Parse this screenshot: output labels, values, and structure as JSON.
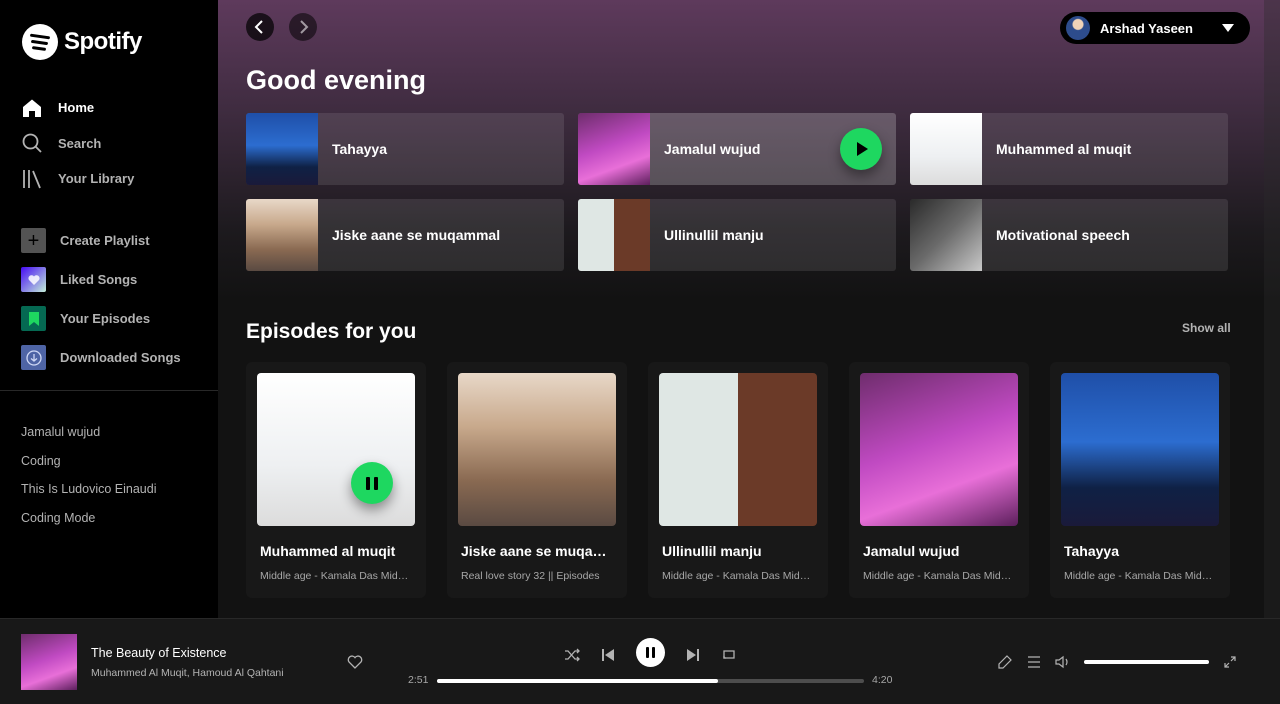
{
  "app": {
    "name": "Spotify"
  },
  "sidebar": {
    "nav": [
      {
        "label": "Home",
        "icon": "home-icon",
        "active": true
      },
      {
        "label": "Search",
        "icon": "search-icon"
      },
      {
        "label": "Your Library",
        "icon": "library-icon"
      }
    ],
    "actions": [
      {
        "label": "Create Playlist",
        "icon": "plus-icon"
      },
      {
        "label": "Liked Songs",
        "icon": "heart-icon"
      },
      {
        "label": "Your Episodes",
        "icon": "bookmark-icon"
      },
      {
        "label": "Downloaded Songs",
        "icon": "download-icon"
      }
    ],
    "playlists": [
      "Jamalul wujud",
      "Coding",
      "This Is Ludovico Einaudi",
      "Coding Mode"
    ]
  },
  "header": {
    "user_name": "Arshad Yaseen"
  },
  "main": {
    "greeting": "Good evening",
    "quick_picks": [
      {
        "label": "Tahayya"
      },
      {
        "label": "Jamalul wujud"
      },
      {
        "label": "Muhammed al muqit"
      },
      {
        "label": "Jiske aane se muqammal"
      },
      {
        "label": "Ullinullil manju"
      },
      {
        "label": "Motivational speech"
      }
    ],
    "episodes": {
      "title": "Episodes for you",
      "show_all": "Show all",
      "cards": [
        {
          "title": "Muhammed al muqit",
          "subtitle": "Middle age - Kamala Das Middle age..."
        },
        {
          "title": "Jiske aane se muqammal",
          "subtitle": "Real love story 32 || Episodes"
        },
        {
          "title": "Ullinullil manju",
          "subtitle": "Middle age - Kamala Das Middle age..."
        },
        {
          "title": "Jamalul wujud",
          "subtitle": "Middle age - Kamala Das Middle age..."
        },
        {
          "title": "Tahayya",
          "subtitle": "Middle age - Kamala Das Middle age..."
        }
      ]
    }
  },
  "player": {
    "track_title": "The Beauty of Existence",
    "track_artists": "Muhammed Al Muqit, Hamoud Al Qahtani",
    "elapsed": "2:51",
    "duration": "4:20",
    "progress_fraction": 0.658,
    "volume_fraction": 1.0
  },
  "colors": {
    "accent": "#1ed760",
    "background": "#121212",
    "sidebar": "#000000",
    "player": "#181818"
  }
}
